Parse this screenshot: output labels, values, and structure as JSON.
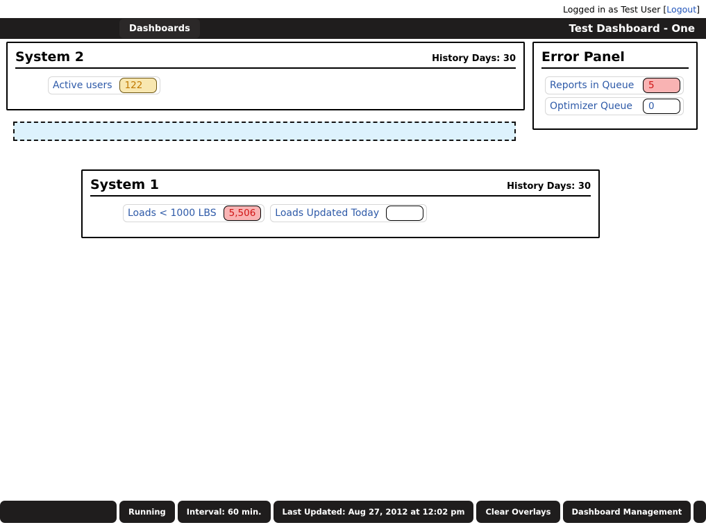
{
  "login_strip": {
    "logged_in_text": "Logged in as Test User",
    "bracket_open": "[",
    "logout_label": "Logout",
    "bracket_close": "]"
  },
  "navbar": {
    "tab_label": "Dashboards",
    "dashboard_title": "Test Dashboard - One"
  },
  "panels": [
    {
      "title": "System 2",
      "meta": "History Days: 30",
      "widgets": [
        {
          "label": "Active users",
          "value": "122",
          "state": "warn"
        }
      ]
    },
    {
      "title": "Error Panel",
      "meta": "",
      "widgets": [
        {
          "label": "Reports in Queue",
          "value": "5",
          "state": "alert"
        },
        {
          "label": "Optimizer Queue",
          "value": "0",
          "state": "plain"
        }
      ]
    },
    {
      "title": "System 1",
      "meta": "History Days: 30",
      "widgets": [
        {
          "label": "Loads < 1000 LBS",
          "value": "5,506",
          "state": "alert"
        },
        {
          "label": "Loads Updated Today",
          "value": "",
          "state": "plain"
        }
      ]
    }
  ],
  "statusbar": {
    "buttons": [
      {
        "label": "Running"
      },
      {
        "label": "Interval: 60 min."
      },
      {
        "label": "Last Updated: Aug 27, 2012 at 12:02 pm"
      },
      {
        "label": "Clear Overlays"
      },
      {
        "label": "Dashboard Management"
      }
    ]
  },
  "colors": {
    "chrome_dark": "#1f1d1d",
    "tab_dark": "#2b2828",
    "link_blue": "#2e5aa8",
    "warn_bg": "#f8e7b0",
    "warn_text": "#c07800",
    "alert_bg": "#f9b3b3",
    "alert_text": "#d01414",
    "dropzone_bg": "#ddf2fd"
  }
}
